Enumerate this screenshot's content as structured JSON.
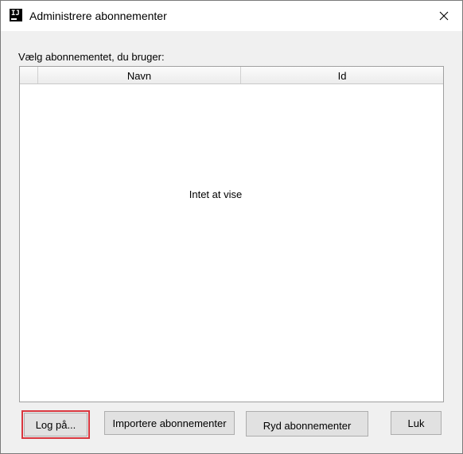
{
  "window": {
    "title": "Administrere abonnementer",
    "icon": "intellij-app-icon",
    "icon_text": "IJ"
  },
  "prompt": "Vælg abonnementet, du bruger:",
  "table": {
    "columns": [
      "",
      "Navn",
      "Id"
    ],
    "rows": [],
    "empty_message": "Intet at vise"
  },
  "buttons": {
    "login": "Log på...",
    "import": "Importere abonnementer",
    "clear": "Ryd abonnementer",
    "close": "Luk"
  },
  "colors": {
    "highlight": "#d9363e"
  }
}
